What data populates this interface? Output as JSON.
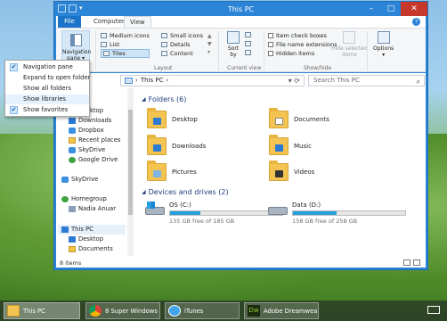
{
  "window": {
    "title": "This PC"
  },
  "ribbon": {
    "tabs": [
      "File",
      "Computer",
      "View"
    ],
    "navigation_pane": [
      "Navigation",
      "pane"
    ],
    "layout": {
      "items": [
        "Medium icons",
        "List",
        "Tiles",
        "Small icons",
        "Details",
        "Content"
      ],
      "label": "Layout"
    },
    "current_view": {
      "sort": [
        "Sort",
        "by"
      ],
      "label": "Current view"
    },
    "show_hide": {
      "checkboxes": [
        "Item check boxes",
        "File name extensions",
        "Hidden items"
      ],
      "hide_selected": [
        "Hide selected",
        "items"
      ],
      "label": "Show/hide"
    },
    "options": "Options"
  },
  "address": {
    "path": "This PC",
    "search_placeholder": "Search This PC"
  },
  "nav_menu": {
    "items": [
      {
        "label": "Navigation pane",
        "checked": true
      },
      {
        "label": "Expand to open folder",
        "checked": false
      },
      {
        "label": "Show all folders",
        "checked": false
      },
      {
        "label": "Show libraries",
        "checked": false
      },
      {
        "label": "Show favorites",
        "checked": true
      }
    ]
  },
  "navtree": {
    "items": [
      "rites",
      "Desktop",
      "Downloads",
      "Dropbox",
      "Recent places",
      "SkyDrive",
      "Google Drive",
      "SkyDrive",
      "Homegroup",
      "Nadia Anuar",
      "This PC",
      "Desktop",
      "Documents"
    ]
  },
  "folders": {
    "header": "Folders (6)",
    "items": [
      "Desktop",
      "Documents",
      "Downloads",
      "Music",
      "Pictures",
      "Videos"
    ]
  },
  "drives": {
    "header": "Devices and drives (2)",
    "items": [
      {
        "name": "OS (C:)",
        "free": "135 GB free of 185 GB",
        "used_fraction": 0.27
      },
      {
        "name": "Data (D:)",
        "free": "158 GB free of 258 GB",
        "used_fraction": 0.39
      }
    ]
  },
  "status": {
    "count": "8 items"
  },
  "taskbar": {
    "items": [
      "This PC",
      "8 Super Windows ...",
      "iTunes",
      "Adobe Dreamwea..."
    ],
    "dw_logo": "Dw"
  },
  "colors": {
    "accent": "#2b84d6",
    "close": "#c7382c",
    "drive_bar": "#26a0da"
  }
}
